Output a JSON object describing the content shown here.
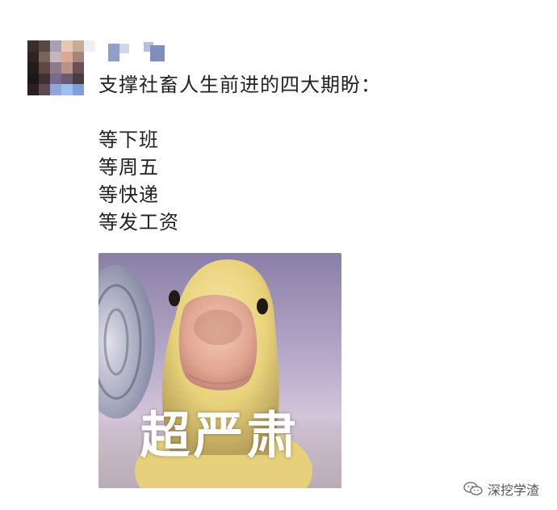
{
  "post": {
    "text": {
      "headline": "支撑社畜人生前进的四大期盼：",
      "lines": [
        "等下班",
        "等周五",
        "等快递",
        "等发工资"
      ]
    },
    "image": {
      "caption": "超严肃",
      "subject_icon": "duck-icon"
    }
  },
  "watermark": {
    "label": "深挖学渣",
    "icon": "wechat-logo-icon"
  },
  "colors": {
    "text": "#222222",
    "caption": "#ffffff",
    "watermark": "#555555"
  }
}
